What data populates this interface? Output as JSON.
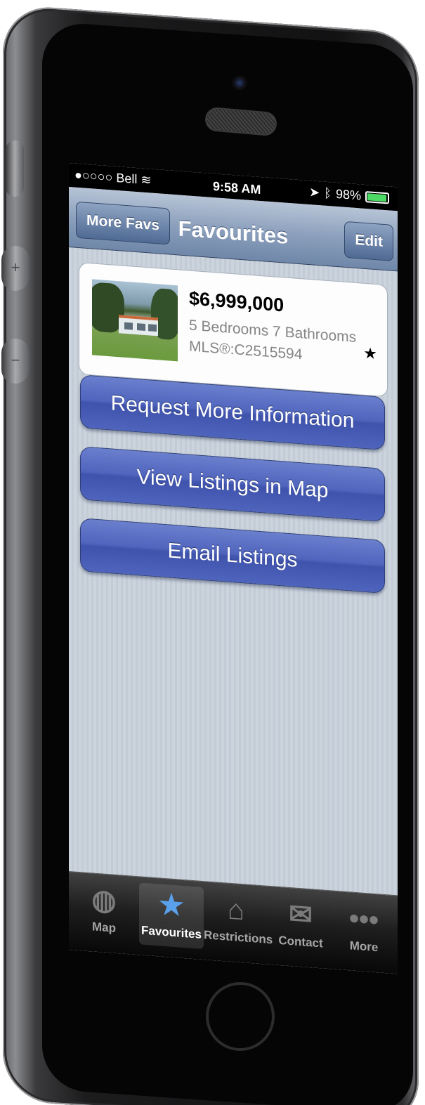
{
  "status_bar": {
    "carrier": "●○○○○ Bell",
    "time": "9:58 AM",
    "battery": "98%",
    "battery_level": 0.98
  },
  "nav_bar": {
    "title": "Favourites",
    "left_button": "More Favs",
    "right_button": "Edit"
  },
  "listing": {
    "price": "$6,999,000",
    "details": "5 Bedrooms 7 Bathrooms",
    "mls": "MLS®:C2515594",
    "favourite": true
  },
  "actions": {
    "request_info": "Request More Information",
    "view_map": "View Listings in Map",
    "email": "Email Listings"
  },
  "tab_bar": {
    "selected": "favourites",
    "tabs": [
      {
        "id": "map",
        "label": "Map",
        "icon": "globe-icon"
      },
      {
        "id": "favourites",
        "label": "Favourites",
        "icon": "stars-icon"
      },
      {
        "id": "restrictions",
        "label": "Restrictions",
        "icon": "house-radar-icon"
      },
      {
        "id": "contact",
        "label": "Contact",
        "icon": "phone-mail-icon"
      },
      {
        "id": "more",
        "label": "More",
        "icon": "ellipsis-icon"
      }
    ]
  }
}
